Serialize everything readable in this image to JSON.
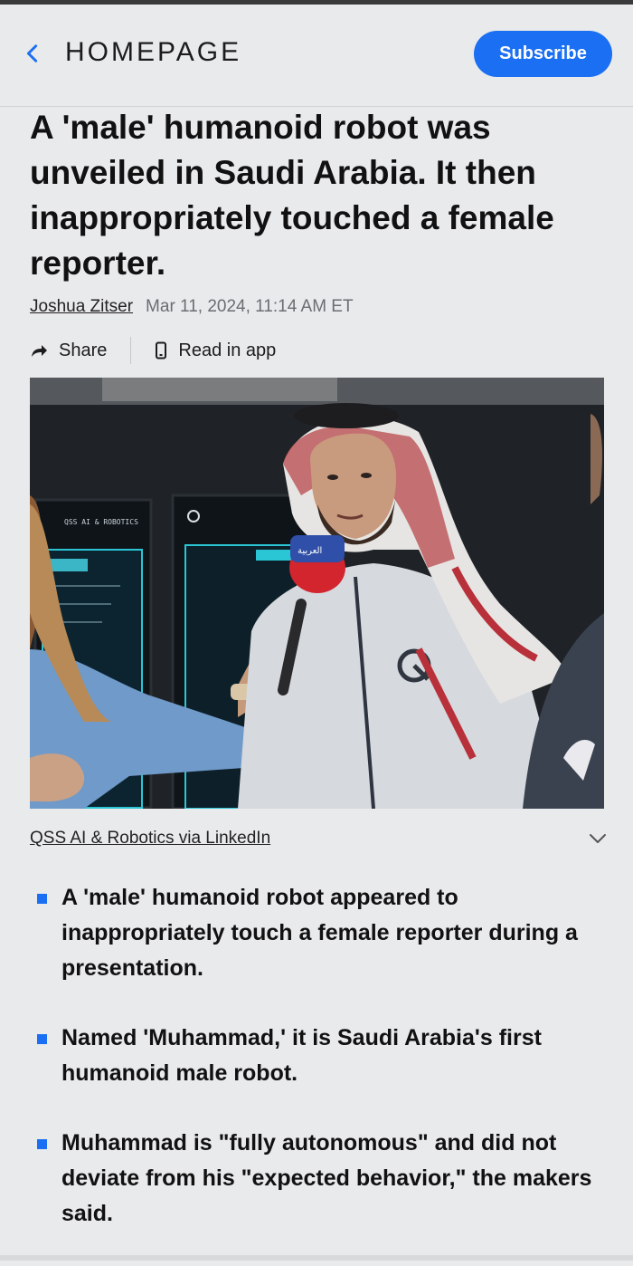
{
  "header": {
    "back_icon": "chevron-left-icon",
    "title": "HOMEPAGE",
    "subscribe_label": "Subscribe",
    "accent_color": "#1a6ff2"
  },
  "article": {
    "headline": "A 'male' humanoid robot was unveiled in Saudi Arabia. It then inappropriately touched a female reporter.",
    "author": "Joshua Zitser",
    "timestamp": "Mar 11, 2024, 11:14 AM ET",
    "actions": {
      "share_label": "Share",
      "share_icon": "share-arrow-icon",
      "read_in_app_label": "Read in app",
      "read_in_app_icon": "phone-icon"
    },
    "image": {
      "monitor_text": "QSS AI & ROBOTICS",
      "mic_flag_text": "العربية"
    },
    "image_credit": "QSS AI & Robotics via LinkedIn",
    "expand_icon": "chevron-down-icon",
    "bullets": [
      "A 'male' humanoid robot appeared to inappropriately touch a female reporter during a presentation.",
      "Named 'Muhammad,' it is Saudi Arabia's first humanoid male robot.",
      "Muhammad is \"fully autonomous\" and did not deviate from his \"expected behavior,\" the makers said."
    ]
  }
}
